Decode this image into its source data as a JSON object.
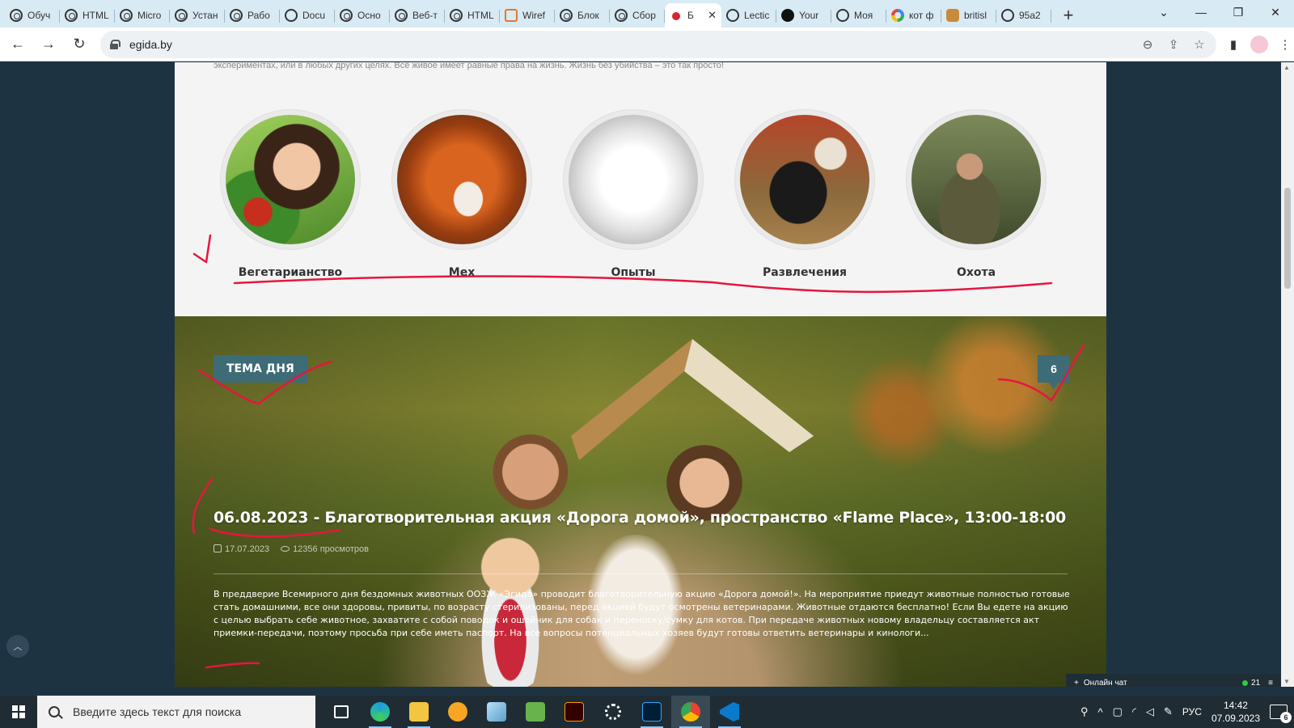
{
  "browser": {
    "tabs": [
      {
        "label": "Обуч",
        "icon": "chatgpt-icon"
      },
      {
        "label": "HTML",
        "icon": "chatgpt-icon"
      },
      {
        "label": "Micro",
        "icon": "chatgpt-icon"
      },
      {
        "label": "Устан",
        "icon": "chatgpt-icon"
      },
      {
        "label": "Рабо",
        "icon": "chatgpt-icon"
      },
      {
        "label": "Docu",
        "icon": "globe-icon"
      },
      {
        "label": "Осно",
        "icon": "chatgpt-icon"
      },
      {
        "label": "Веб-т",
        "icon": "chatgpt-icon"
      },
      {
        "label": "HTML",
        "icon": "chatgpt-icon"
      },
      {
        "label": "Wiref",
        "icon": "wireframe-icon"
      },
      {
        "label": "Блок",
        "icon": "chatgpt-icon"
      },
      {
        "label": "Сбор",
        "icon": "chatgpt-icon"
      },
      {
        "label": "Б",
        "icon": "paw-icon"
      },
      {
        "label": "Lectic",
        "icon": "globe-icon"
      },
      {
        "label": "Your",
        "icon": "github-icon"
      },
      {
        "label": "Моя",
        "icon": "globe-icon"
      },
      {
        "label": "кот ф",
        "icon": "google-icon"
      },
      {
        "label": "britisl",
        "icon": "cat-icon"
      },
      {
        "label": "95a2",
        "icon": "globe-icon"
      }
    ],
    "url": "egida.by"
  },
  "page": {
    "intro_tail": "экспериментах, или в любых других целях. Всё живое имеет равные права на жизнь. Жизнь без убийства – это так просто!",
    "categories": [
      {
        "label": "Вегетарианство"
      },
      {
        "label": "Мех"
      },
      {
        "label": "Опыты"
      },
      {
        "label": "Развлечения"
      },
      {
        "label": "Охота"
      }
    ],
    "hero": {
      "badge": "ТЕМА ДНЯ",
      "count": "6",
      "title": "06.08.2023 - Благотворительная акция «Дорога домой», пространство «Flame Place», 13:00-18:00",
      "date": "17.07.2023",
      "views": "12356 просмотров",
      "excerpt": "В преддверие Всемирного дня бездомных животных ООЗЖ «Эгида» проводит благотворительную акцию «Дорога домой!». На мероприятие приедут животные полностью готовые стать домашними, все они здоровы, привиты, по возрасту стерилизованы, перед акцией будут осмотрены ветеринарами. Животные отдаются бесплатно! Если Вы едете на акцию с целью выбрать себе животное, захватите с собой поводок и ошейник для собак и переноску/сумку для котов. При передаче животных новому владельцу составляется акт приемки-передачи, поэтому просьба при себе иметь паспорт. На все вопросы потенциальных хозяев будут готовы ответить ветеринары и кинологи..."
    },
    "chat": {
      "label": "Онлайн чат",
      "online": "21"
    }
  },
  "taskbar": {
    "search_placeholder": "Введите здесь текст для поиска",
    "lang": "РУС",
    "time": "14:42",
    "date": "07.09.2023",
    "notifications": "6"
  }
}
